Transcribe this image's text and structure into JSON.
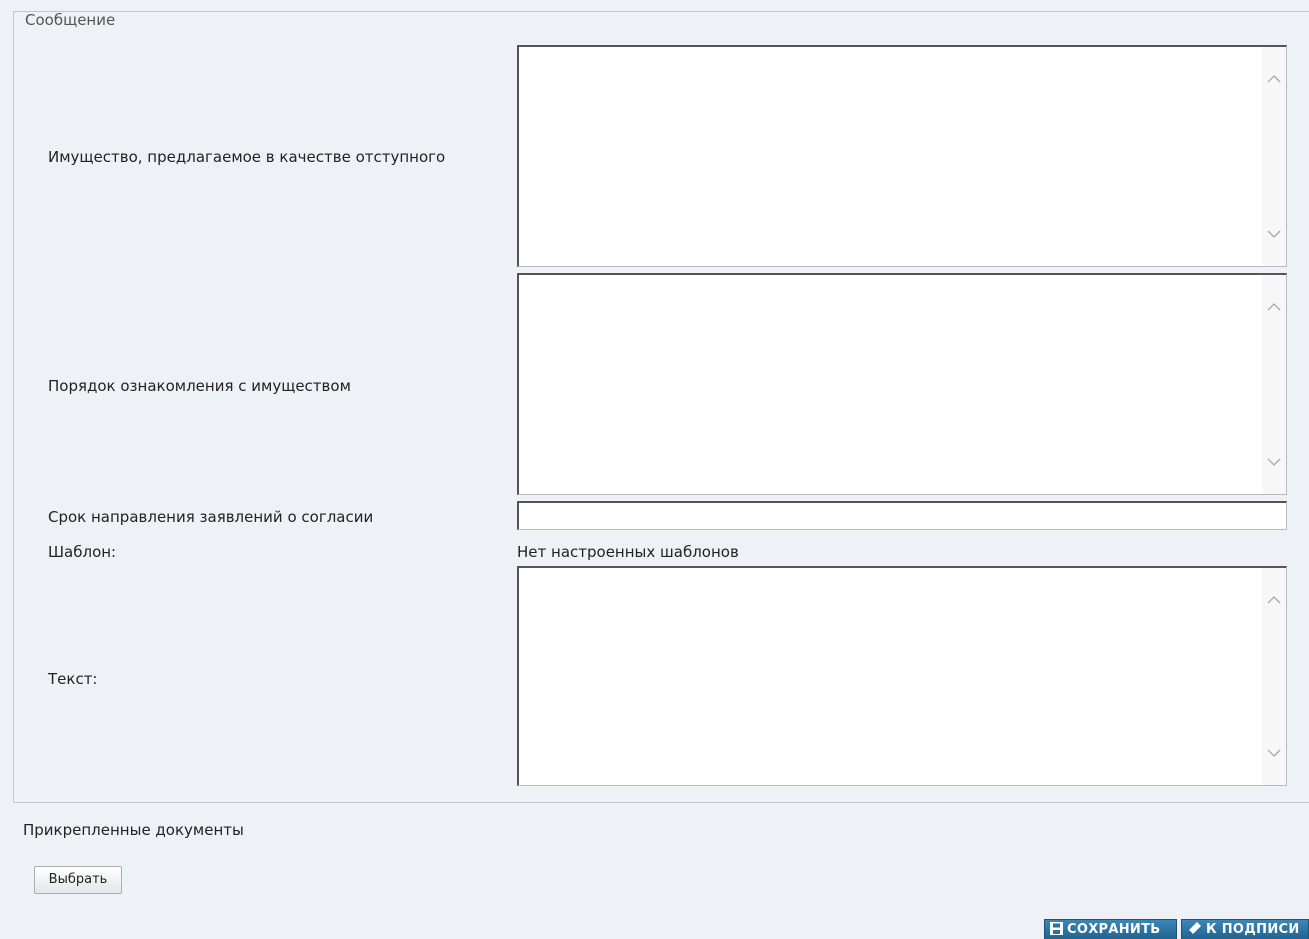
{
  "fieldset": {
    "legend": "Сообщение"
  },
  "fields": {
    "property_label": "Имущество, предлагаемое в качестве отступного",
    "procedure_label": "Порядок ознакомления с имуществом",
    "deadline_label": "Срок направления заявлений о согласии",
    "template_label": "Шаблон:",
    "template_value": "Нет настроенных шаблонов",
    "text_label": "Текст:"
  },
  "attachments": {
    "label": "Прикрепленные документы",
    "choose_button": "Выбрать"
  },
  "actions": {
    "save_label": "СОХРАНИТЬ",
    "sign_label": "К ПОДПИСИ"
  },
  "colors": {
    "background": "#eef2f7",
    "action_button": "#2a6f9e"
  }
}
